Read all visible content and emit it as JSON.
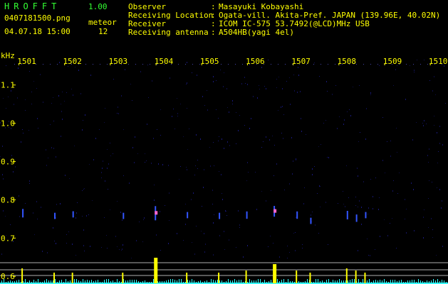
{
  "app": {
    "name": "HROFFT",
    "version": "1.00"
  },
  "file": {
    "name": "0407181500.png",
    "datetime": "04.07.18 15:00"
  },
  "meteor": {
    "label": "meteor",
    "count": "12"
  },
  "info": [
    {
      "key": "Observer",
      "value": "Masayuki Kobayashi"
    },
    {
      "key": "Receiving Location",
      "value": "Ogata-vill. Akita-Pref. JAPAN (139.96E, 40.02N)"
    },
    {
      "key": "Receiver",
      "value": "ICOM IC-575 53.7492(@LCD)MHz USB"
    },
    {
      "key": "Receiving antenna",
      "value": "A504HB(yagi 4el)"
    }
  ],
  "colors": {
    "background": "#000000",
    "text": "#ffff00",
    "brand": "#33ff33",
    "noise": "#1a1a80",
    "echo": "#3355ff",
    "echo_core": "#ff66cc",
    "level_bar": "#ffff00",
    "level_low": "#33ffff",
    "ref_line": "#b0b0b0"
  },
  "chart_data": {
    "type": "heatmap",
    "y_unit": "kHz",
    "x_ticks": [
      "1501",
      "1502",
      "1503",
      "1504",
      "1505",
      "1506",
      "1507",
      "1508",
      "1509",
      "1510"
    ],
    "y_ticks": [
      "1.1",
      "1.0",
      "0.9",
      "0.8",
      "0.7",
      "0.6"
    ],
    "ylim": [
      0.58,
      1.17
    ],
    "xlim": [
      1500.4,
      1510.2
    ],
    "echoes": [
      {
        "x": 1500.9,
        "y": 0.765,
        "strength": 0.5
      },
      {
        "x": 1501.6,
        "y": 0.758,
        "strength": 0.3
      },
      {
        "x": 1502.0,
        "y": 0.762,
        "strength": 0.3
      },
      {
        "x": 1503.1,
        "y": 0.758,
        "strength": 0.3
      },
      {
        "x": 1503.8,
        "y": 0.765,
        "strength": 1.0
      },
      {
        "x": 1504.5,
        "y": 0.76,
        "strength": 0.3
      },
      {
        "x": 1505.2,
        "y": 0.758,
        "strength": 0.3
      },
      {
        "x": 1505.8,
        "y": 0.76,
        "strength": 0.4
      },
      {
        "x": 1506.4,
        "y": 0.77,
        "strength": 0.7
      },
      {
        "x": 1506.9,
        "y": 0.76,
        "strength": 0.4
      },
      {
        "x": 1507.2,
        "y": 0.745,
        "strength": 0.3
      },
      {
        "x": 1508.0,
        "y": 0.76,
        "strength": 0.5
      },
      {
        "x": 1508.2,
        "y": 0.752,
        "strength": 0.4
      },
      {
        "x": 1508.4,
        "y": 0.76,
        "strength": 0.3
      }
    ]
  }
}
